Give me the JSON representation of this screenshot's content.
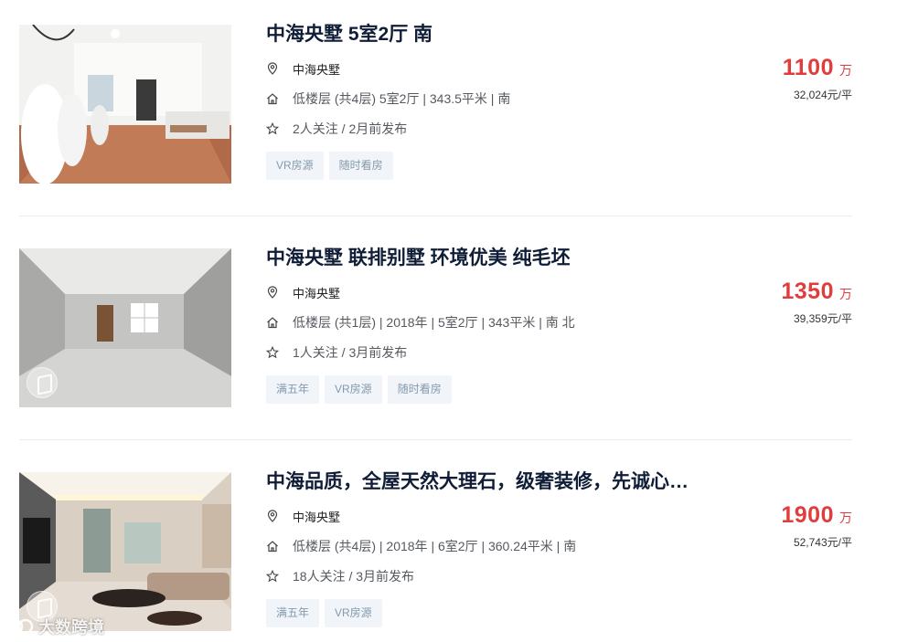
{
  "listings": [
    {
      "title": "中海央墅 5室2厅 南",
      "community": "中海央墅",
      "detail": "低楼层 (共4层) 5室2厅 | 343.5平米 | 南",
      "follow": "2人关注 / 2月前发布",
      "tags": [
        "VR房源",
        "随时看房"
      ],
      "price": "1100",
      "price_unit": "万",
      "unit_price": "32,024元/平",
      "photo": "white-villa-interior-wedding-dresses"
    },
    {
      "title": "中海央墅 联排别墅 环境优美 纯毛坯",
      "community": "中海央墅",
      "detail": "低楼层 (共1层) | 2018年 | 5室2厅 | 343平米 | 南 北",
      "follow": "1人关注 / 3月前发布",
      "tags": [
        "满五年",
        "VR房源",
        "随时看房"
      ],
      "price": "1350",
      "price_unit": "万",
      "unit_price": "39,359元/平",
      "photo": "unfinished-concrete-room"
    },
    {
      "title": "中海品质，全屋天然大理石，级奢装修，先诚心…",
      "community": "中海央墅",
      "detail": "低楼层 (共4层) | 2018年 | 6室2厅 | 360.24平米 | 南",
      "follow": "18人关注 / 3月前发布",
      "tags": [
        "满五年",
        "VR房源"
      ],
      "price": "1900",
      "price_unit": "万",
      "unit_price": "52,743元/平",
      "photo": "luxury-marble-living-room"
    }
  ],
  "icons": {
    "location": "location-pin-icon",
    "house": "house-icon",
    "star": "star-icon",
    "vr": "vr-360-icon"
  },
  "colors": {
    "price": "#e03d3d",
    "title": "#101d37",
    "tag_bg": "#f1f4f8",
    "tag_text": "#849aae"
  },
  "watermark": "大数跨境"
}
